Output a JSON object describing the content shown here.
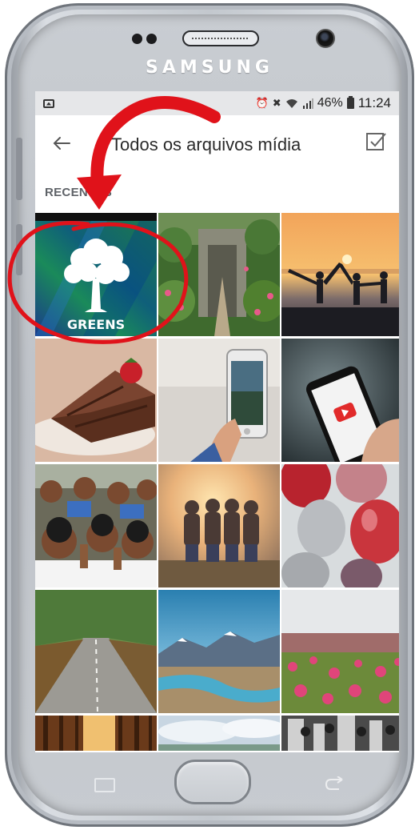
{
  "device": {
    "brand": "SAMSUNG"
  },
  "statusbar": {
    "battery": "46%",
    "time": "11:24"
  },
  "appbar": {
    "title": "Todos os arquivos mídia"
  },
  "section": {
    "label": "RECENTES"
  },
  "gallery": {
    "items": [
      {
        "name": "greens-logo",
        "caption": "GREENS"
      },
      {
        "name": "garden-gate"
      },
      {
        "name": "sunset-silhouettes"
      },
      {
        "name": "chocolate-cake"
      },
      {
        "name": "phone-photo"
      },
      {
        "name": "phone-youtube"
      },
      {
        "name": "kids-group"
      },
      {
        "name": "friends-sunset"
      },
      {
        "name": "balloons"
      },
      {
        "name": "tree-road"
      },
      {
        "name": "mountain-river"
      },
      {
        "name": "flower-field"
      },
      {
        "name": "forest-light"
      },
      {
        "name": "cloud-sky"
      },
      {
        "name": "crowd-bw"
      }
    ]
  },
  "colors": {
    "annotation": "#e0121a",
    "status_bar_bg": "#e6e7e9",
    "section_label": "#5f6368"
  }
}
